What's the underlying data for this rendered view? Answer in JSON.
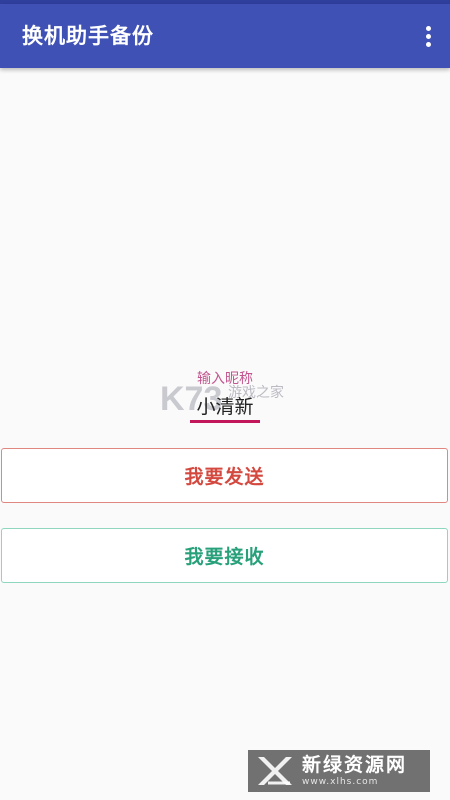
{
  "app_bar": {
    "title": "换机助手备份",
    "overflow_icon": "more-vertical-icon",
    "color": "#3f51b5"
  },
  "nickname": {
    "label": "输入昵称",
    "value": "小清新",
    "accent_color": "#c2185b"
  },
  "actions": {
    "send_label": "我要发送",
    "send_color": "#d4493f",
    "receive_label": "我要接收",
    "receive_color": "#28a07a"
  },
  "watermarks": {
    "k73_logo": "K73",
    "k73_text": "游戏之家",
    "xlhs_title": "新绿资源网",
    "xlhs_url": "www.xlhs.com"
  }
}
